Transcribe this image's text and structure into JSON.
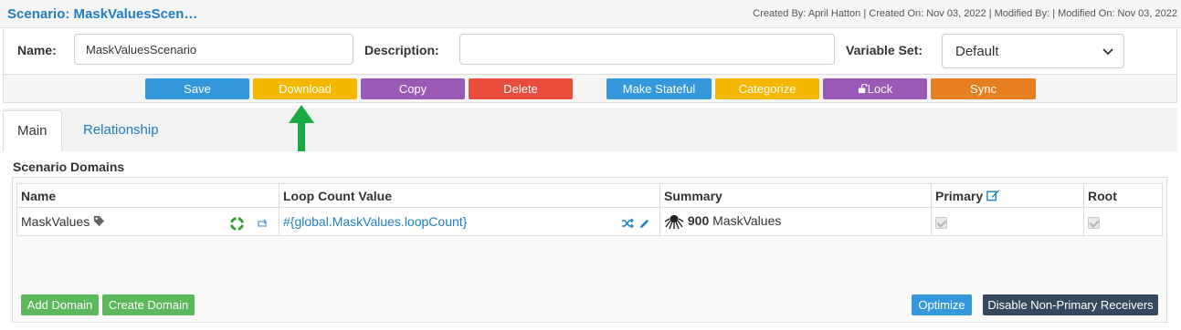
{
  "header": {
    "title": "Scenario: MaskValuesScen…",
    "meta": "Created By: April Hatton | Created On: Nov 03, 2022 | Modified By: | Modified On: Nov 03, 2022"
  },
  "form": {
    "name_label": "Name:",
    "name_value": "MaskValuesScenario",
    "description_label": "Description:",
    "description_value": "",
    "variable_set_label": "Variable Set:",
    "variable_set_value": "Default"
  },
  "toolbar": {
    "save": "Save",
    "download": "Download",
    "copy": "Copy",
    "delete": "Delete",
    "make_stateful": "Make Stateful",
    "categorize": "Categorize",
    "lock": "Lock",
    "sync": "Sync"
  },
  "tabs": [
    {
      "label": "Main"
    },
    {
      "label": "Relationship"
    }
  ],
  "section_title": "Scenario Domains",
  "table": {
    "headers": [
      "Name",
      "Loop Count Value",
      "Summary",
      "Primary",
      "Root"
    ],
    "rows": [
      {
        "name": "MaskValues",
        "loop_count": "#{global.MaskValues.loopCount}",
        "summary_count": "900",
        "summary_name": "MaskValues"
      }
    ]
  },
  "footer": {
    "add_domain": "Add Domain",
    "create_domain": "Create Domain",
    "optimize": "Optimize",
    "disable_non_primary": "Disable Non-Primary Receivers"
  },
  "colors": {
    "accent": "#1d7fc2",
    "save": "#3498db",
    "download": "#f5b700",
    "copy": "#9b59b6",
    "delete": "#e74c3c",
    "sync": "#e67e22",
    "add_domain": "#5cb85c",
    "disable": "#34495e",
    "arrow": "#1aaa44"
  },
  "icons": [
    "tag-icon",
    "lifebuoy-icon",
    "repeat-icon",
    "shuffle-icon",
    "pencil-icon",
    "octopus-icon",
    "edit-icon",
    "unlock-icon",
    "chevron-down-icon",
    "up-arrow-icon"
  ]
}
